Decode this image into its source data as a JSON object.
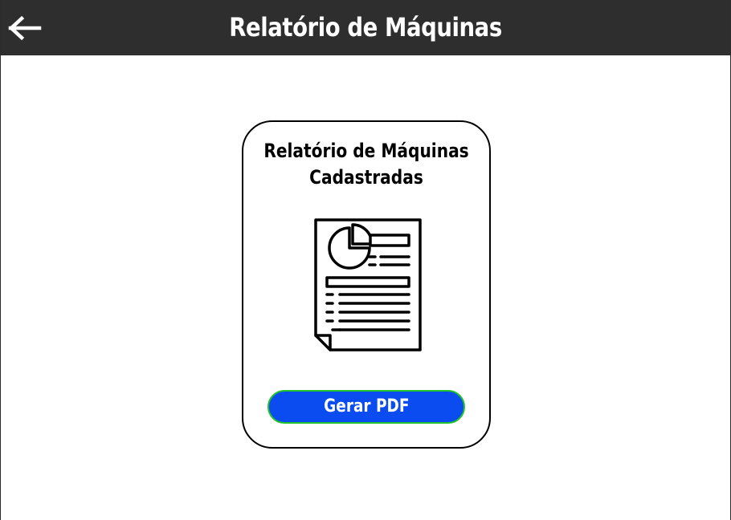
{
  "header": {
    "title": "Relatório de Máquinas",
    "back_icon": "arrow-left-icon"
  },
  "card": {
    "title": "Relatório de Máquinas\nCadastradas",
    "icon": "document-report-icon",
    "button_label": "Gerar PDF"
  },
  "colors": {
    "header_bg": "#2e2e2e",
    "button_bg": "#0a4cf0",
    "button_border": "#22c22e",
    "text": "#000000"
  }
}
